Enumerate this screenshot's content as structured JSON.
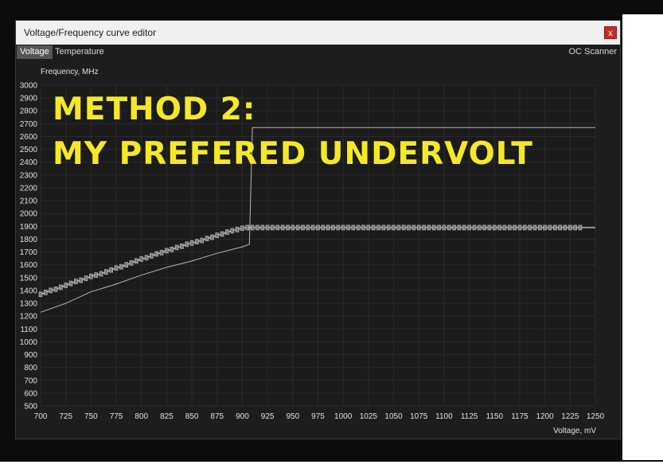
{
  "window": {
    "title": "Voltage/Frequency curve editor",
    "close_label": "x"
  },
  "tabs": [
    {
      "label": "Voltage",
      "active": true
    },
    {
      "label": "Temperature",
      "active": false
    }
  ],
  "oc_scanner_label": "OC Scanner",
  "overlay": {
    "line1": "METHOD 2:",
    "line2": "MY PREFERED UNDERVOLT",
    "color": "#f5e827"
  },
  "colors": {
    "plot_bg": "#1b1b1b",
    "grid": "#2b2b2d",
    "curve": "#b8b8b8",
    "curve_light": "#e6e6e6",
    "tick_text": "#e0e0e0"
  },
  "chart_data": {
    "type": "line",
    "xlabel": "Voltage, mV",
    "ylabel": "Frequency, MHz",
    "xlim": [
      700,
      1250
    ],
    "ylim": [
      500,
      3000
    ],
    "x_ticks": [
      700,
      725,
      750,
      775,
      800,
      825,
      850,
      875,
      900,
      925,
      950,
      975,
      1000,
      1025,
      1050,
      1075,
      1100,
      1125,
      1150,
      1175,
      1200,
      1225,
      1250
    ],
    "y_ticks": [
      500,
      600,
      700,
      800,
      900,
      1000,
      1100,
      1200,
      1300,
      1400,
      1500,
      1600,
      1700,
      1800,
      1900,
      2000,
      2100,
      2200,
      2300,
      2400,
      2500,
      2600,
      2700,
      2800,
      2900,
      3000
    ],
    "grid": true,
    "series": [
      {
        "role": "default-curve",
        "points": [
          [
            700,
            1230
          ],
          [
            725,
            1300
          ],
          [
            750,
            1390
          ],
          [
            775,
            1450
          ],
          [
            800,
            1520
          ],
          [
            825,
            1580
          ],
          [
            850,
            1630
          ],
          [
            875,
            1690
          ],
          [
            900,
            1740
          ],
          [
            907,
            1760
          ],
          [
            910,
            2670
          ],
          [
            1250,
            2670
          ]
        ]
      },
      {
        "role": "edited-curve",
        "x": [
          700,
          705,
          710,
          715,
          720,
          725,
          730,
          735,
          740,
          745,
          750,
          755,
          760,
          765,
          770,
          775,
          780,
          785,
          790,
          795,
          800,
          805,
          810,
          815,
          820,
          825,
          830,
          835,
          840,
          845,
          850,
          855,
          860,
          865,
          870,
          875,
          880,
          885,
          890,
          895,
          900,
          905,
          910,
          915,
          920,
          925,
          930,
          935,
          940,
          945,
          950,
          955,
          960,
          965,
          970,
          975,
          980,
          985,
          990,
          995,
          1000,
          1005,
          1010,
          1015,
          1020,
          1025,
          1030,
          1035,
          1040,
          1045,
          1050,
          1055,
          1060,
          1065,
          1070,
          1075,
          1080,
          1085,
          1090,
          1095,
          1100,
          1105,
          1110,
          1115,
          1120,
          1125,
          1130,
          1135,
          1140,
          1145,
          1150,
          1155,
          1160,
          1165,
          1170,
          1175,
          1180,
          1185,
          1190,
          1195,
          1200,
          1205,
          1210,
          1215,
          1220,
          1225,
          1230,
          1235
        ],
        "y": [
          1370,
          1385,
          1400,
          1410,
          1425,
          1440,
          1455,
          1470,
          1480,
          1495,
          1510,
          1520,
          1530,
          1545,
          1560,
          1575,
          1585,
          1600,
          1615,
          1630,
          1645,
          1655,
          1670,
          1685,
          1695,
          1710,
          1720,
          1735,
          1745,
          1760,
          1770,
          1780,
          1790,
          1805,
          1815,
          1830,
          1840,
          1855,
          1865,
          1875,
          1885,
          1890,
          1890,
          1890,
          1890,
          1890,
          1890,
          1890,
          1890,
          1890,
          1890,
          1890,
          1890,
          1890,
          1890,
          1890,
          1890,
          1890,
          1890,
          1890,
          1890,
          1890,
          1890,
          1890,
          1890,
          1890,
          1890,
          1890,
          1890,
          1890,
          1890,
          1890,
          1890,
          1890,
          1890,
          1890,
          1890,
          1890,
          1890,
          1890,
          1890,
          1890,
          1890,
          1890,
          1890,
          1890,
          1890,
          1890,
          1890,
          1890,
          1890,
          1890,
          1890,
          1890,
          1890,
          1890,
          1890,
          1890,
          1890,
          1890,
          1890,
          1890,
          1890,
          1890,
          1890,
          1890,
          1890,
          1890
        ],
        "flat_extends_to": 1250
      }
    ]
  }
}
